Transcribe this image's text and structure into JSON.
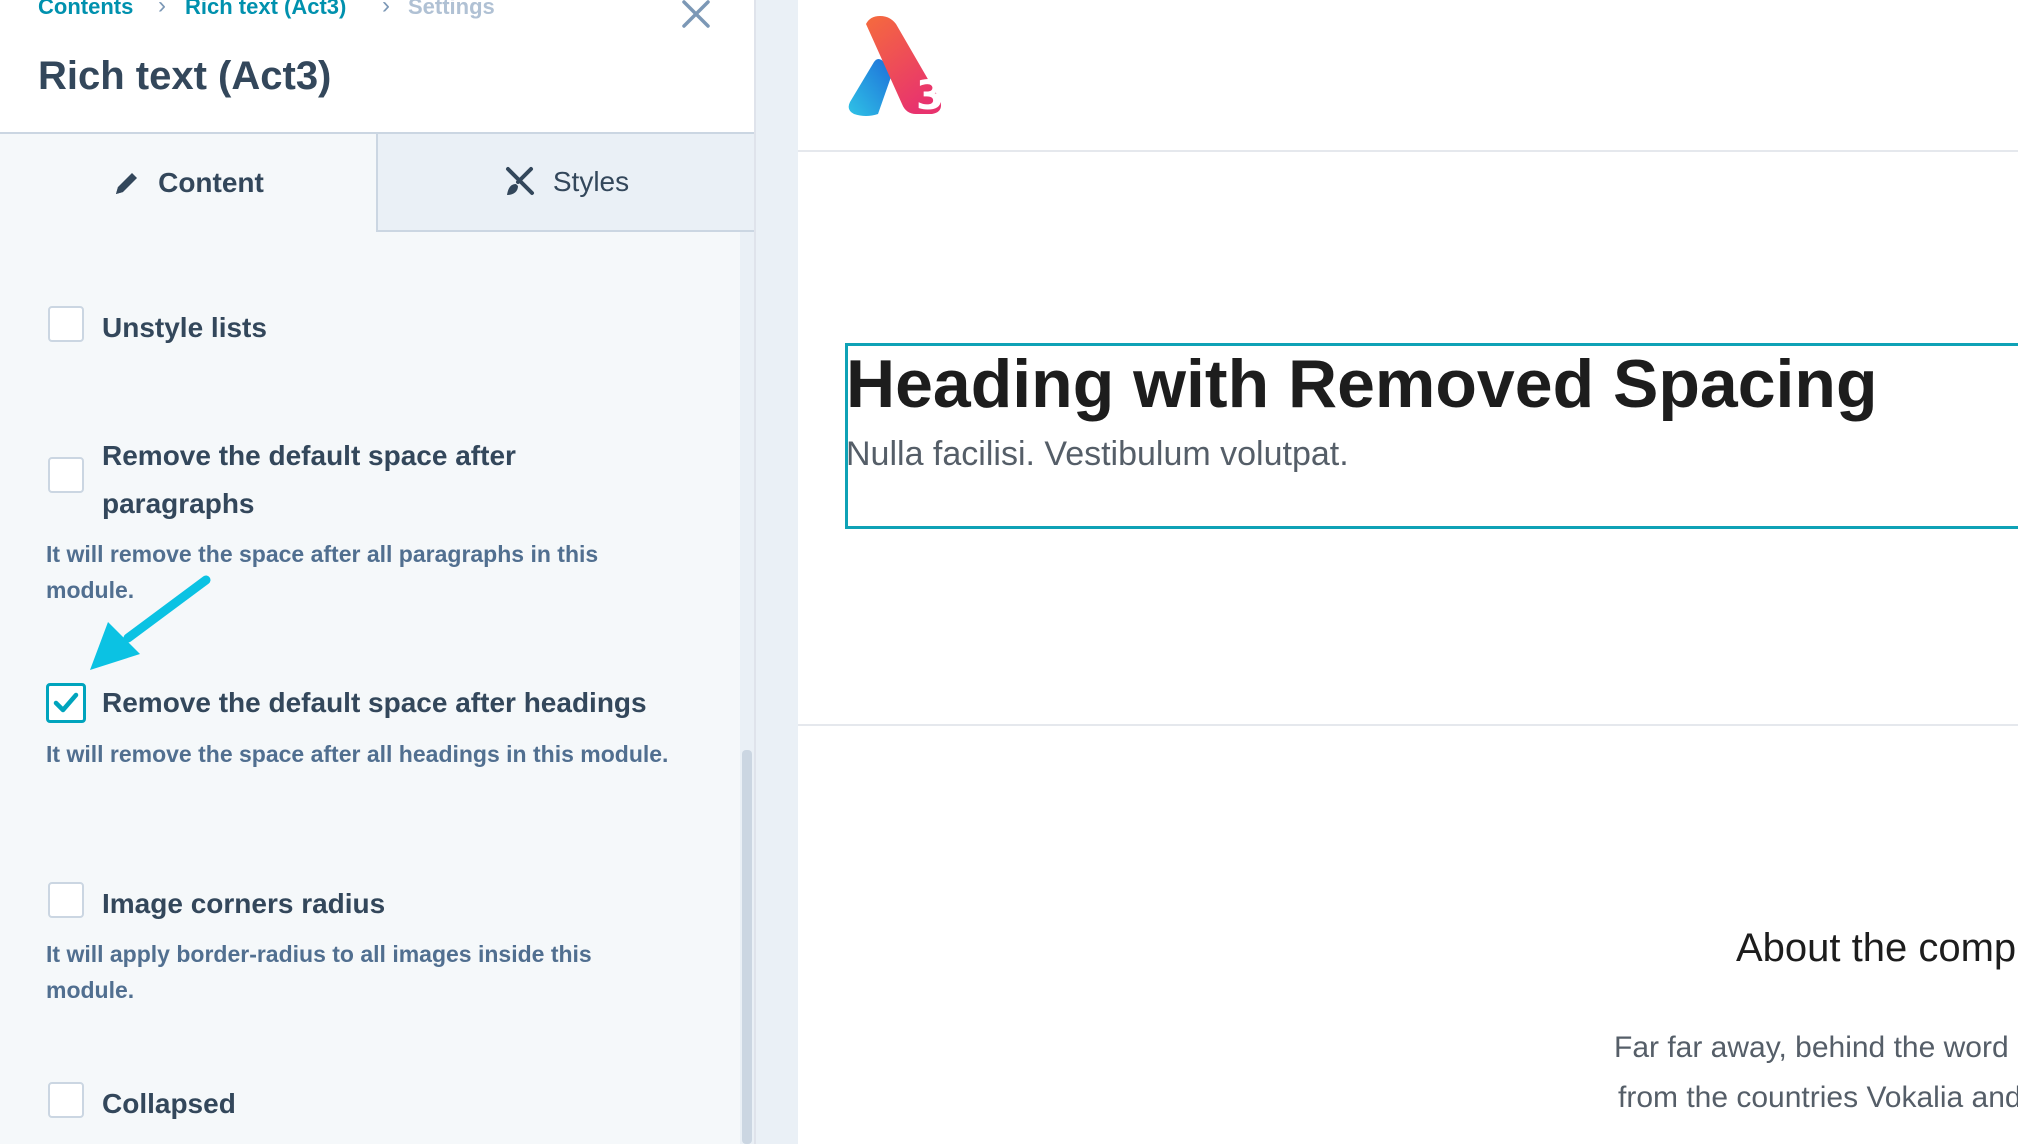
{
  "breadcrumb": {
    "items": [
      "Contents",
      "Rich text (Act3)",
      "Settings"
    ],
    "separator": "›"
  },
  "panel": {
    "title": "Rich text (Act3)",
    "tabs": [
      {
        "label": "Content",
        "icon": "pencil-icon",
        "active": true
      },
      {
        "label": "Styles",
        "icon": "brush-icon",
        "active": false
      }
    ],
    "options": [
      {
        "label": "Unstyle lists",
        "checked": false,
        "help": ""
      },
      {
        "label": "Remove the default space after paragraphs",
        "checked": false,
        "help": "It will remove the space after all paragraphs in this module."
      },
      {
        "label": "Remove the default space after headings",
        "checked": true,
        "help": "It will remove the space after all headings in this module."
      },
      {
        "label": "Image corners radius",
        "checked": false,
        "help": "It will apply border-radius to all images inside this module."
      },
      {
        "label": "Collapsed",
        "checked": false,
        "help": ""
      }
    ]
  },
  "preview": {
    "heading": "Heading with Removed Spacing",
    "paragraph": "Nulla facilisi. Vestibulum volutpat.",
    "about_title": "About the comp",
    "about_lines": [
      "Far far away, behind the word",
      "from the countries Vokalia and"
    ]
  },
  "colors": {
    "accent": "#00a4bd",
    "link": "#0091ae",
    "text_dark": "#33475b",
    "text_help": "#516f90",
    "annotation_arrow": "#0bc2e3",
    "logo_gradient_start": "#f56b3d",
    "logo_gradient_end": "#e8336e"
  }
}
